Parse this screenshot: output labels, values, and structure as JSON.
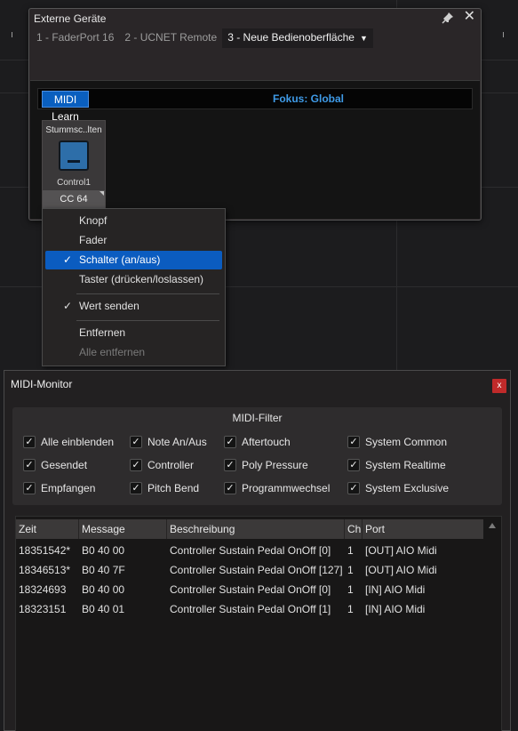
{
  "external_devices": {
    "title": "Externe Geräte",
    "tabs": [
      {
        "label": "1 - FaderPort 16"
      },
      {
        "label": "2 - UCNET Remote"
      },
      {
        "label": "3 - Neue Bedienoberfläche"
      }
    ],
    "midi_learn_label": "MIDI Learn",
    "focus_label": "Fokus: Global",
    "control": {
      "name": "Stummsc..lten",
      "label": "Control1",
      "cc": "CC 64"
    }
  },
  "context_menu": {
    "items": [
      {
        "label": "Knopf",
        "checked": false,
        "selected": false,
        "disabled": false
      },
      {
        "label": "Fader",
        "checked": false,
        "selected": false,
        "disabled": false
      },
      {
        "label": "Schalter (an/aus)",
        "checked": true,
        "selected": true,
        "disabled": false
      },
      {
        "label": "Taster (drücken/loslassen)",
        "checked": false,
        "selected": false,
        "disabled": false
      },
      {
        "label": "Wert senden",
        "checked": true,
        "selected": false,
        "disabled": false
      },
      {
        "label": "Entfernen",
        "checked": false,
        "selected": false,
        "disabled": false
      },
      {
        "label": "Alle entfernen",
        "checked": false,
        "selected": false,
        "disabled": true
      }
    ]
  },
  "midi_monitor": {
    "title": "MIDI-Monitor",
    "close_label": "x",
    "filter_title": "MIDI-Filter",
    "filters": [
      {
        "label": "Alle einblenden",
        "checked": true
      },
      {
        "label": "Note An/Aus",
        "checked": true
      },
      {
        "label": "Aftertouch",
        "checked": true
      },
      {
        "label": "System Common",
        "checked": true
      },
      {
        "label": "Gesendet",
        "checked": true
      },
      {
        "label": "Controller",
        "checked": true
      },
      {
        "label": "Poly Pressure",
        "checked": true
      },
      {
        "label": "System Realtime",
        "checked": true
      },
      {
        "label": "Empfangen",
        "checked": true
      },
      {
        "label": "Pitch Bend",
        "checked": true
      },
      {
        "label": "Programmwechsel",
        "checked": true
      },
      {
        "label": "System Exclusive",
        "checked": true
      }
    ],
    "columns": [
      "Zeit",
      "Message",
      "Beschreibung",
      "Ch",
      "Port"
    ],
    "rows": [
      [
        "18351542*",
        "B0 40 00",
        "Controller Sustain Pedal OnOff [0]",
        "1",
        "[OUT] AIO Midi"
      ],
      [
        "18346513*",
        "B0 40 7F",
        "Controller Sustain Pedal OnOff [127]",
        "1",
        "[OUT] AIO Midi"
      ],
      [
        "18324693",
        "B0 40 00",
        "Controller Sustain Pedal OnOff [0]",
        "1",
        "[IN] AIO Midi"
      ],
      [
        "18323151",
        "B0 40 01",
        "Controller Sustain Pedal OnOff [1]",
        "1",
        "[IN] AIO Midi"
      ]
    ]
  },
  "colors": {
    "accent": "#0b5cc0",
    "focus_text": "#3f9be8",
    "close_red": "#c02a2a"
  }
}
